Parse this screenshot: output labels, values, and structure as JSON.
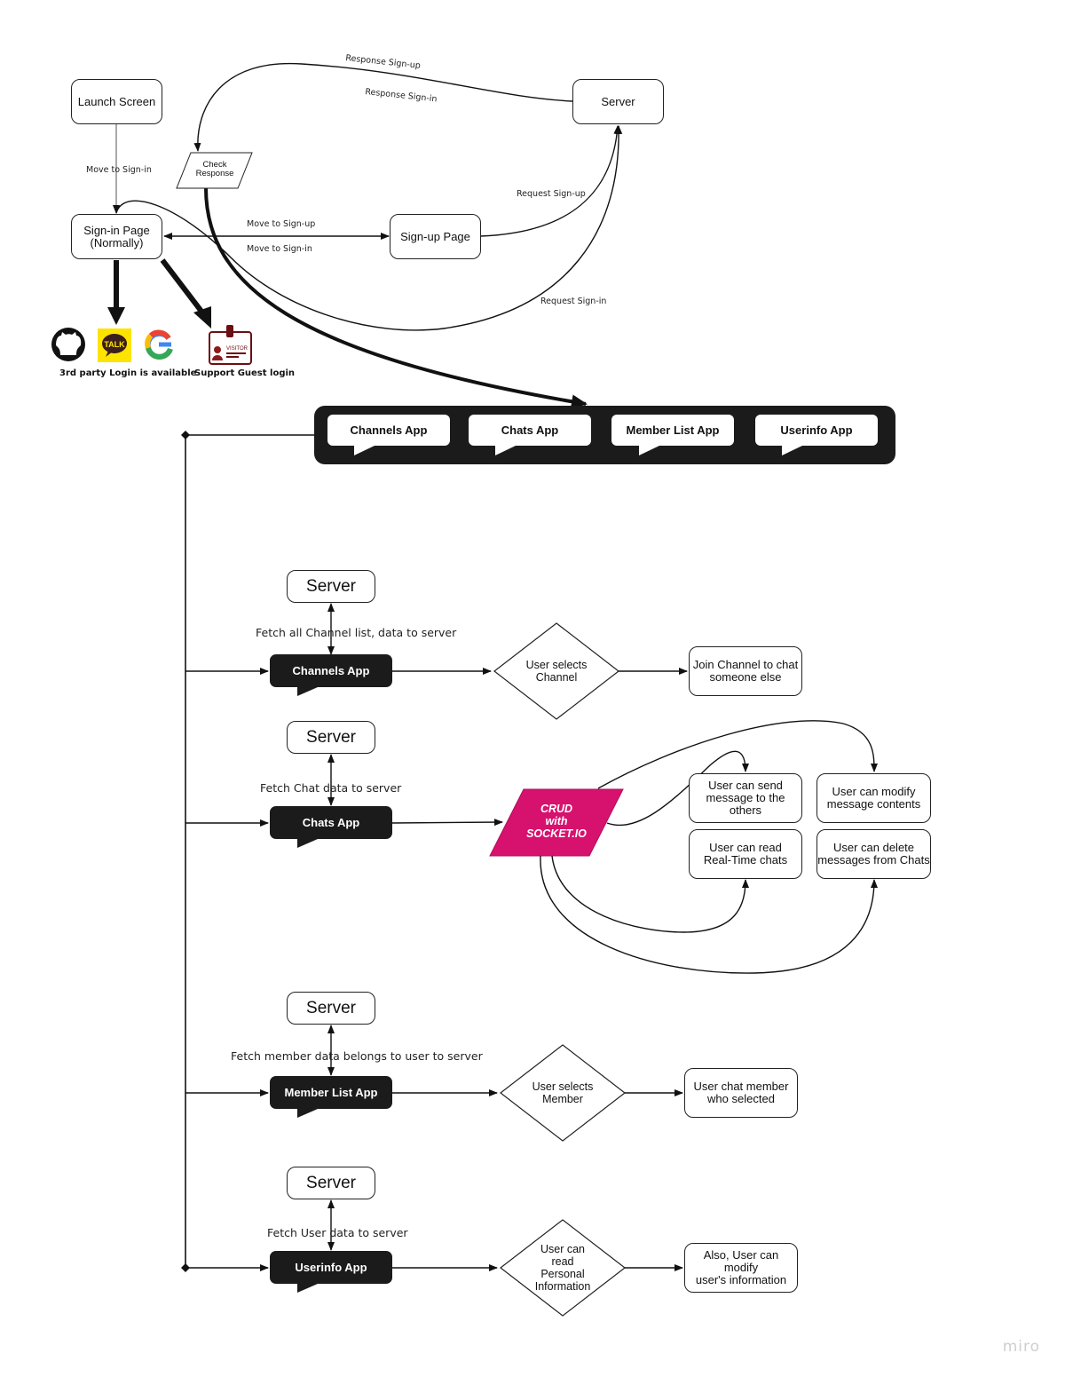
{
  "top_flow": {
    "launch_screen": "Launch Screen",
    "server": "Server",
    "check_response": "Check\nResponse",
    "signin_page": "Sign-in Page\n(Normally)",
    "signup_page": "Sign-up Page",
    "edges": {
      "move_to_signin_launch": "Move to Sign-in",
      "move_to_signup": "Move to Sign-up",
      "move_to_signin": "Move to Sign-in",
      "response_signup": "Response Sign-up",
      "response_signin": "Response Sign-in",
      "request_signup": "Request Sign-up",
      "request_signin": "Request Sign-in"
    },
    "third_party_caption": "3rd party Login is available",
    "guest_caption": "Support Guest login",
    "third_party_icons": [
      "github-icon",
      "kakaotalk-icon",
      "google-icon"
    ],
    "kakao_label": "TALK",
    "visitor_label": "VISITOR"
  },
  "apps_bar": {
    "tabs": [
      "Channels App",
      "Chats App",
      "Member List App",
      "Userinfo App"
    ]
  },
  "sections": {
    "channels": {
      "server": "Server",
      "fetch_label": "Fetch all Channel list, data to server",
      "app": "Channels App",
      "decision": "User selects\nChannel",
      "result": "Join Channel to chat\nsomeone else"
    },
    "chats": {
      "server": "Server",
      "fetch_label": "Fetch Chat data to server",
      "app": "Chats App",
      "crud": "CRUD\nwith\nSOCKET.IO",
      "crud_color": "#d6126e",
      "actions": [
        "User can send\nmessage to the others",
        "User can modify\nmessage contents",
        "User can read\nReal-Time chats",
        "User can delete\nmessages from Chats"
      ]
    },
    "members": {
      "server": "Server",
      "fetch_label": "Fetch member data belongs to user to server",
      "app": "Member List App",
      "decision": "User selects\nMember",
      "result": "User chat member\nwho selected"
    },
    "userinfo": {
      "server": "Server",
      "fetch_label": "Fetch User data to server",
      "app": "Userinfo App",
      "decision": "User can\nread\nPersonal\nInformation",
      "result": "Also, User can modify\nuser's information"
    }
  },
  "watermark": "miro"
}
